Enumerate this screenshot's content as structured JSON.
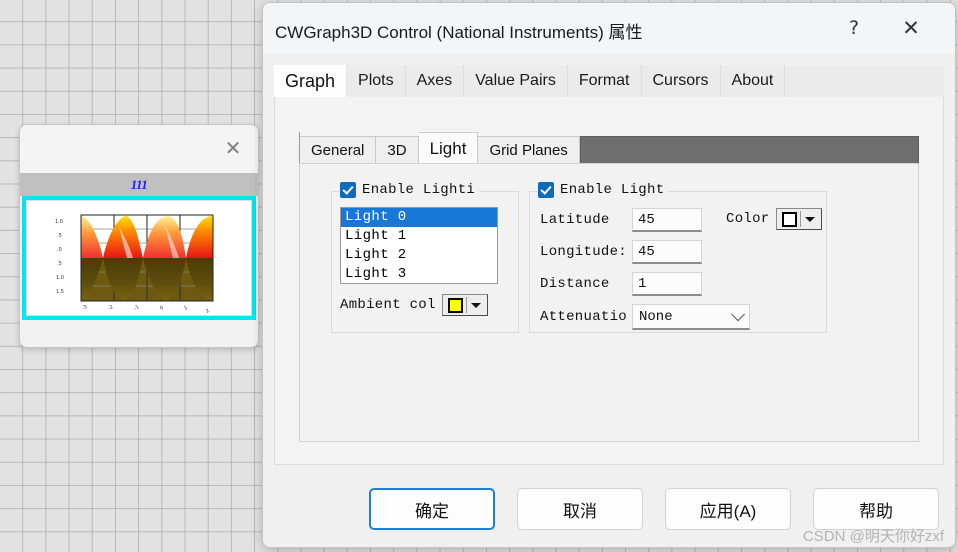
{
  "mini_window": {
    "close_icon": "close-icon",
    "caption": "111",
    "graph": {
      "description": "3D surface plot thumbnail with red-orange-yellow upper surface and dark brown lower surface"
    }
  },
  "dialog": {
    "title": "CWGraph3D Control  (National Instruments) 属性",
    "help_glyph": "?",
    "close_glyph": "✕",
    "outer_tabs": [
      {
        "label": "Graph",
        "active": true
      },
      {
        "label": "Plots",
        "active": false
      },
      {
        "label": "Axes",
        "active": false
      },
      {
        "label": "Value Pairs",
        "active": false
      },
      {
        "label": "Format",
        "active": false
      },
      {
        "label": "Cursors",
        "active": false
      },
      {
        "label": "About",
        "active": false
      }
    ],
    "inner_tabs": [
      {
        "label": "General",
        "active": false
      },
      {
        "label": "3D",
        "active": false
      },
      {
        "label": "Light",
        "active": true
      },
      {
        "label": "Grid Planes",
        "active": false
      }
    ],
    "lighting_group": {
      "enable_label": "Enable Lighti",
      "enable_checked": true,
      "lights": [
        {
          "label": "Light 0",
          "selected": true
        },
        {
          "label": "Light 1",
          "selected": false
        },
        {
          "label": "Light 2",
          "selected": false
        },
        {
          "label": "Light 3",
          "selected": false
        }
      ],
      "ambient_label": "Ambient col",
      "ambient_color": "#ffff00"
    },
    "light_group": {
      "enable_label": "Enable Light",
      "enable_checked": true,
      "latitude_label": "Latitude",
      "latitude_value": "45",
      "longitude_label": "Longitude:",
      "longitude_value": "45",
      "distance_label": "Distance",
      "distance_value": "1",
      "attenuation_label": "Attenuatio",
      "attenuation_value": "None",
      "color_label": "Color",
      "color_value": "#ffffff"
    },
    "buttons": [
      {
        "label": "确定",
        "default": true
      },
      {
        "label": "取消",
        "default": false
      },
      {
        "label": "应用(A)",
        "default": false
      },
      {
        "label": "帮助",
        "default": false
      }
    ]
  },
  "watermark": "CSDN @明天你好zxf",
  "colors": {
    "accent": "#0f6cbd",
    "selection": "#1878d8",
    "mini_frame": "#00e5f0",
    "caption_text": "#2020ee"
  }
}
